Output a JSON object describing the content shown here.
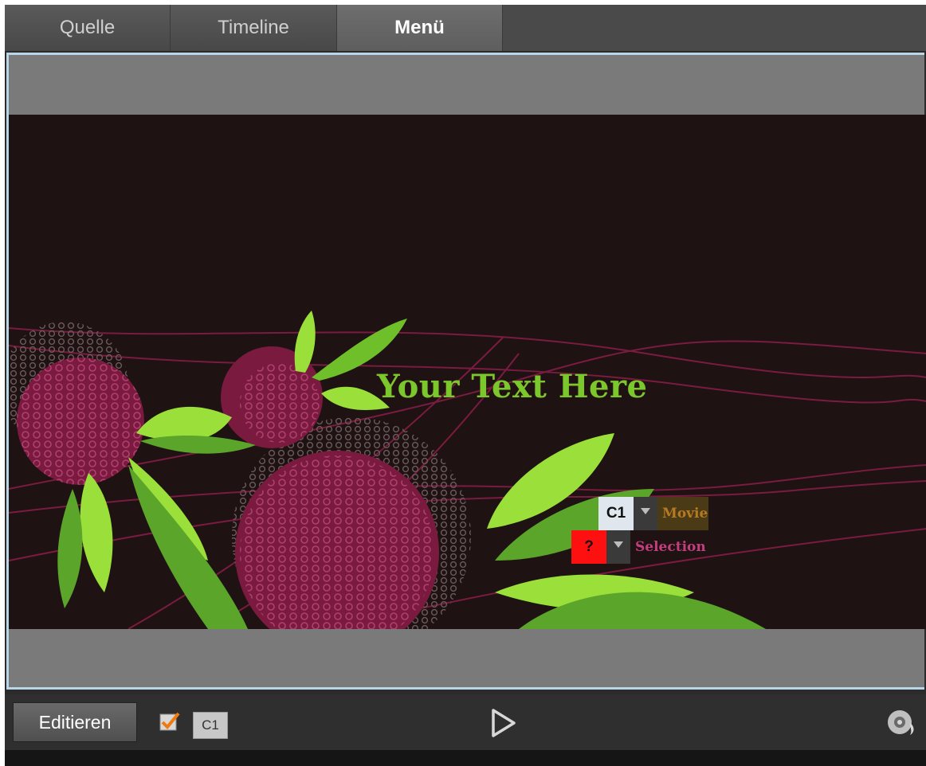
{
  "tabs": [
    {
      "label": "Quelle"
    },
    {
      "label": "Timeline"
    },
    {
      "label": "Menü",
      "active": true
    }
  ],
  "preview": {
    "title": "Your Text Here",
    "buttons": [
      {
        "badge": "C1",
        "label": "Movie"
      },
      {
        "badge": "?",
        "label": "Selection"
      }
    ],
    "colors": {
      "background": "#1e1213",
      "title": "#7ac82c",
      "circle": "#8a1f45",
      "leaf_light": "#9be03a",
      "leaf_dark": "#5aa52a"
    }
  },
  "toolbar": {
    "edit_label": "Editieren",
    "chapter_label": "C1",
    "play_icon": "play-icon",
    "disc_icon": "disc-burn-icon"
  }
}
